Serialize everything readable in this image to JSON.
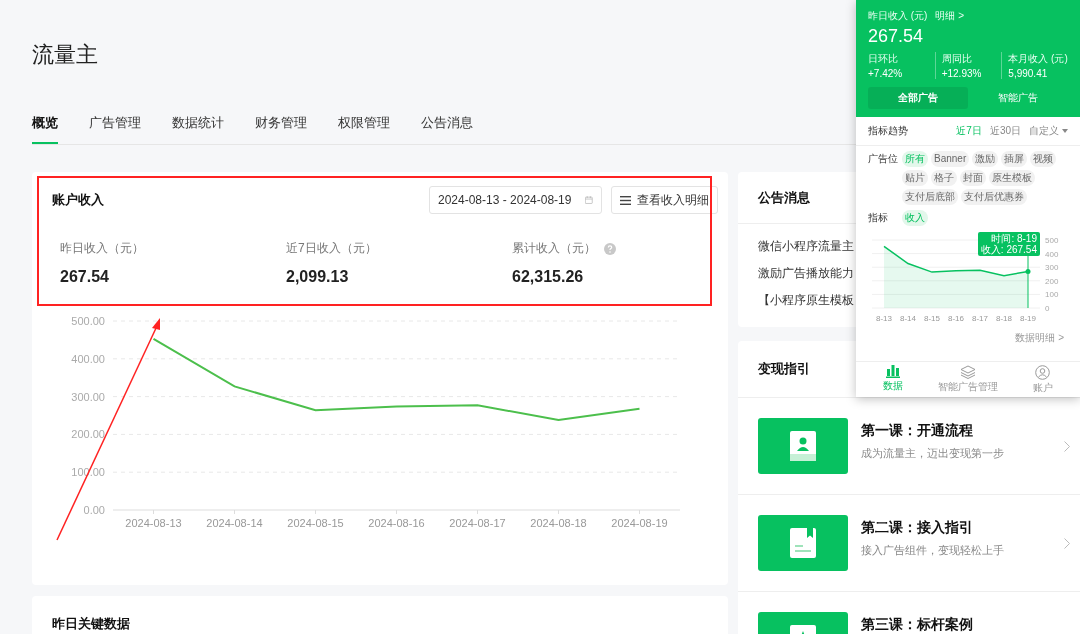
{
  "page": {
    "title": "流量主"
  },
  "tabs": [
    {
      "label": "概览",
      "selected": true
    },
    {
      "label": "广告管理",
      "selected": false
    },
    {
      "label": "数据统计",
      "selected": false
    },
    {
      "label": "财务管理",
      "selected": false
    },
    {
      "label": "权限管理",
      "selected": false
    },
    {
      "label": "公告消息",
      "selected": false
    }
  ],
  "income_card": {
    "title": "账户收入",
    "date_range": "2024-08-13 - 2024-08-19",
    "detail_button": "查看收入明细",
    "stats": [
      {
        "label": "昨日收入（元）",
        "value": "267.54",
        "help": false
      },
      {
        "label": "近7日收入（元）",
        "value": "2,099.13",
        "help": false
      },
      {
        "label": "累计收入（元）",
        "value": "62,315.26",
        "help": true
      }
    ],
    "chart_data": {
      "type": "line",
      "categories": [
        "2024-08-13",
        "2024-08-14",
        "2024-08-15",
        "2024-08-16",
        "2024-08-17",
        "2024-08-18",
        "2024-08-19"
      ],
      "series": [
        {
          "color": "#4cbf4c",
          "values": [
            453,
            327,
            264,
            274,
            277,
            238,
            268
          ]
        }
      ],
      "ylim": [
        0,
        500
      ],
      "grid": true,
      "yticks": [
        {
          "value": 0,
          "label": "0.00"
        },
        {
          "value": 100,
          "label": "100.00"
        },
        {
          "value": 200,
          "label": "200.00"
        },
        {
          "value": 300,
          "label": "300.00"
        },
        {
          "value": 400,
          "label": "400.00"
        },
        {
          "value": 500,
          "label": "500.00"
        }
      ]
    }
  },
  "key_data_card": {
    "title": "昨日关键数据"
  },
  "announcements": {
    "title": "公告消息",
    "items": [
      "微信小程序流量主",
      "激励广告播放能力",
      "【小程序原生模板"
    ]
  },
  "guide": {
    "title": "变现指引",
    "lessons": [
      {
        "kind": "person",
        "title": "第一课：开通流程",
        "subtitle": "成为流量主，迈出变现第一步"
      },
      {
        "kind": "book",
        "title": "第二课：接入指引",
        "subtitle": "接入广告组件，变现轻松上手"
      },
      {
        "kind": "star",
        "title": "第三课：标杆案例"
      }
    ]
  },
  "mobile_panel": {
    "header": {
      "label": "昨日收入 (元)",
      "link": "明细 >",
      "value": "267.54",
      "stats": [
        {
          "label": "日环比",
          "value": "+7.42%"
        },
        {
          "label": "周同比",
          "value": "+12.93%"
        },
        {
          "label": "本月收入 (元)",
          "value": "5,990.41"
        }
      ],
      "segments": [
        {
          "label": "全部广告",
          "selected": true
        },
        {
          "label": "智能广告",
          "selected": false
        }
      ]
    },
    "trend": {
      "title": "指标趋势",
      "ranges": [
        {
          "label": "近7日",
          "selected": true
        },
        {
          "label": "近30日",
          "selected": false
        },
        {
          "label": "自定义",
          "selected": false,
          "dropdown": true
        }
      ],
      "filters": [
        {
          "label": "广告位",
          "chips": [
            {
              "label": "所有",
              "selected": true
            },
            {
              "label": "Banner",
              "selected": false
            },
            {
              "label": "激励",
              "selected": false
            },
            {
              "label": "插屏",
              "selected": false
            },
            {
              "label": "视频",
              "selected": false
            },
            {
              "label": "贴片",
              "selected": false
            },
            {
              "label": "格子",
              "selected": false
            },
            {
              "label": "封面",
              "selected": false
            },
            {
              "label": "原生模板",
              "selected": false
            },
            {
              "label": "支付后底部",
              "selected": false
            },
            {
              "label": "支付后优惠券",
              "selected": false
            }
          ]
        },
        {
          "label": "指标",
          "chips": [
            {
              "label": "收入",
              "selected": true
            }
          ]
        }
      ],
      "chart_data": {
        "type": "area",
        "categories": [
          "8-13",
          "8-14",
          "8-15",
          "8-16",
          "8-17",
          "8-18",
          "8-19"
        ],
        "series": [
          {
            "color": "#07c160",
            "values": [
              453,
              327,
              264,
              274,
              277,
              238,
              268
            ]
          }
        ],
        "ylim": [
          0,
          500
        ],
        "grid": true,
        "yticks": [
          0,
          100,
          200,
          300,
          400,
          500
        ]
      },
      "tooltip": [
        "时间: 8-19",
        "收入: 267.54"
      ],
      "more_link": "数据明细 >"
    },
    "nav": [
      {
        "kind": "chart",
        "label": "数据",
        "selected": true
      },
      {
        "kind": "layers",
        "label": "智能广告管理",
        "selected": false
      },
      {
        "kind": "user",
        "label": "账户",
        "selected": false
      }
    ]
  }
}
